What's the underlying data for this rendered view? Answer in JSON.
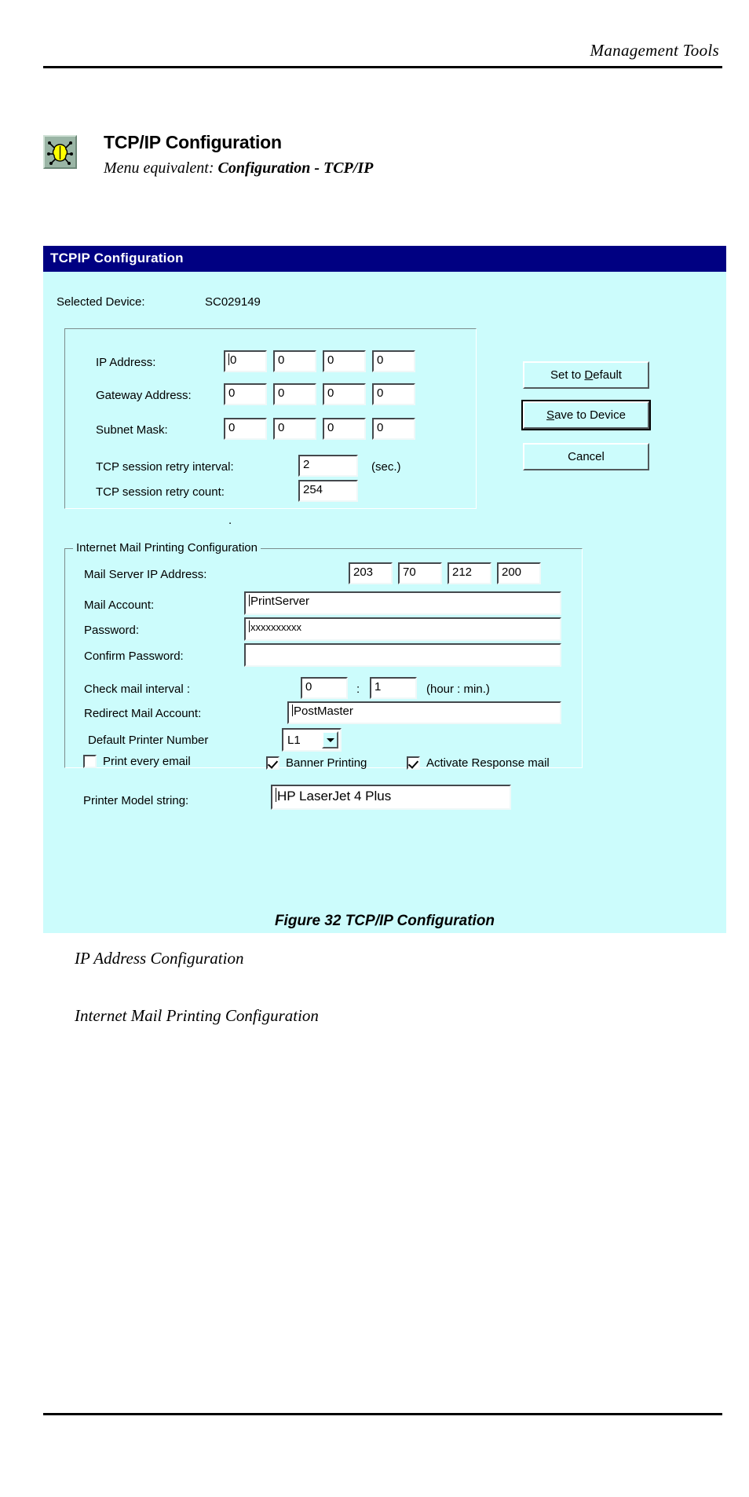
{
  "page": {
    "header_title": "Management Tools",
    "figure_caption": "Figure 32 TCP/IP Configuration",
    "body_paragraphs": [
      "IP Address Configuration",
      "Internet Mail Printing Configuration"
    ]
  },
  "section": {
    "icon": "bug-network-icon",
    "title": "TCP/IP Configuration",
    "menu_equivalent_prefix": "Menu equivalent: ",
    "menu_equivalent_path": "Configuration - TCP/IP"
  },
  "dialog": {
    "title": "TCPIP Configuration",
    "selected_device": {
      "label": "Selected Device:",
      "value": "SC029149"
    },
    "ip_group": {
      "rows": [
        {
          "label": "IP Address:",
          "octets": [
            "0",
            "0",
            "0",
            "0"
          ]
        },
        {
          "label": "Gateway Address:",
          "octets": [
            "0",
            "0",
            "0",
            "0"
          ]
        },
        {
          "label": "Subnet Mask:",
          "octets": [
            "0",
            "0",
            "0",
            "0"
          ]
        }
      ],
      "retry_interval": {
        "label": "TCP session retry interval:",
        "value": "2",
        "units": "(sec.)"
      },
      "retry_count": {
        "label": "TCP session retry count:",
        "value": "254"
      }
    },
    "buttons": {
      "set_to_default": "Set to Default",
      "set_to_default_accel": "D",
      "save_to_device": "Save to Device",
      "save_to_device_accel": "S",
      "cancel": "Cancel"
    },
    "mail_group": {
      "legend": "Internet Mail Printing Configuration",
      "mail_server_ip": {
        "label": "Mail Server IP Address:",
        "octets": [
          "203",
          "70",
          "212",
          "200"
        ]
      },
      "mail_account": {
        "label": "Mail Account:",
        "value": "PrintServer"
      },
      "password": {
        "label": "Password:",
        "value": "xxxxxxxxxx"
      },
      "confirm_password": {
        "label": "Confirm Password:",
        "value": ""
      },
      "check_mail_interval": {
        "label": "Check mail interval :",
        "hours": "0",
        "separator": ":",
        "minutes": "1",
        "units": "(hour : min.)"
      },
      "redirect_mail_account": {
        "label": "Redirect Mail Account:",
        "value": "PostMaster"
      },
      "default_printer_number": {
        "label": "Default Printer Number",
        "value": "L1"
      },
      "print_every_email": {
        "label": "Print every email",
        "checked": false
      },
      "banner_printing": {
        "label": "Banner Printing",
        "checked": true
      },
      "activate_response_mail": {
        "label": "Activate Response mail",
        "checked": true
      },
      "printer_model_string": {
        "label": "Printer Model string:",
        "value": "HP LaserJet 4 Plus"
      }
    },
    "colors": {
      "titlebar": "#000082",
      "dialog_face": "#ccfcfc",
      "field": "#ffffff"
    }
  }
}
